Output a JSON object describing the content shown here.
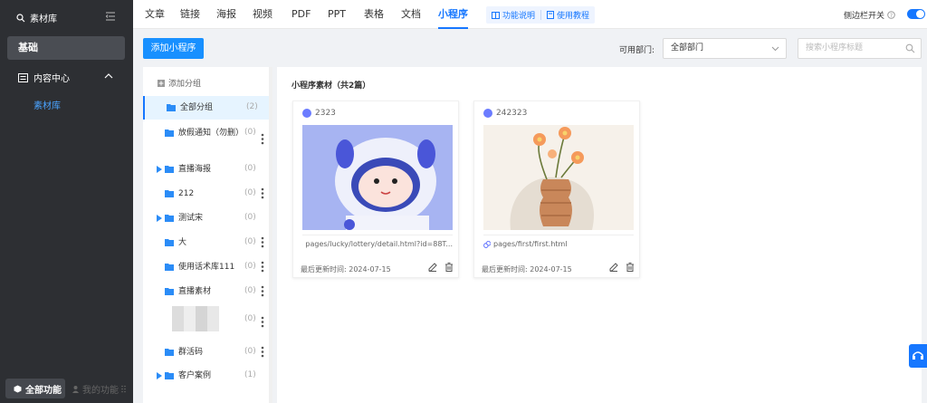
{
  "nav": {
    "search_label": "素材库",
    "base_label": "基础",
    "content_center": "内容中心",
    "sub_item": "素材库",
    "all_functions": "全部功能",
    "my_functions": "我的功能"
  },
  "tabs": [
    "文章",
    "链接",
    "海报",
    "视频",
    "PDF",
    "PPT",
    "表格",
    "文档",
    "小程序"
  ],
  "active_tab": "小程序",
  "tab_group": {
    "feature_desc": "功能说明",
    "tutorial": "使用教程"
  },
  "sidebar_toggle_label": "侧边栏开关",
  "toolbar": {
    "add_button": "添加小程序",
    "dept_label": "可用部门:",
    "dept_value": "全部部门",
    "search_placeholder": "搜索小程序标题"
  },
  "groups": {
    "add_group": "添加分组",
    "items": [
      {
        "name": "全部分组",
        "count": "(2)"
      },
      {
        "name": "放假通知（勿删）",
        "count": "(0)"
      },
      {
        "name": "直播海报",
        "count": "(0)"
      },
      {
        "name": "212",
        "count": "(0)"
      },
      {
        "name": "测试宋",
        "count": "(0)"
      },
      {
        "name": "大",
        "count": "(0)"
      },
      {
        "name": "使用话术库111",
        "count": "(0)"
      },
      {
        "name": "直播素材",
        "count": "(0)"
      },
      {
        "name": "",
        "count": "(0)"
      },
      {
        "name": "群活码",
        "count": "(0)"
      },
      {
        "name": "客户案例",
        "count": "(1)"
      }
    ]
  },
  "main": {
    "header": "小程序素材（共2篇）",
    "cards": [
      {
        "title": "2323",
        "path": "pages/lucky/lottery/detail.html?id=88T...",
        "updated": "最后更新时间:  2024-07-15"
      },
      {
        "title": "242323",
        "path": "pages/first/first.html",
        "updated": "最后更新时间:  2024-07-15"
      }
    ]
  },
  "colors": {
    "accent": "#1677ff",
    "nav_bg": "#2d2f33"
  }
}
